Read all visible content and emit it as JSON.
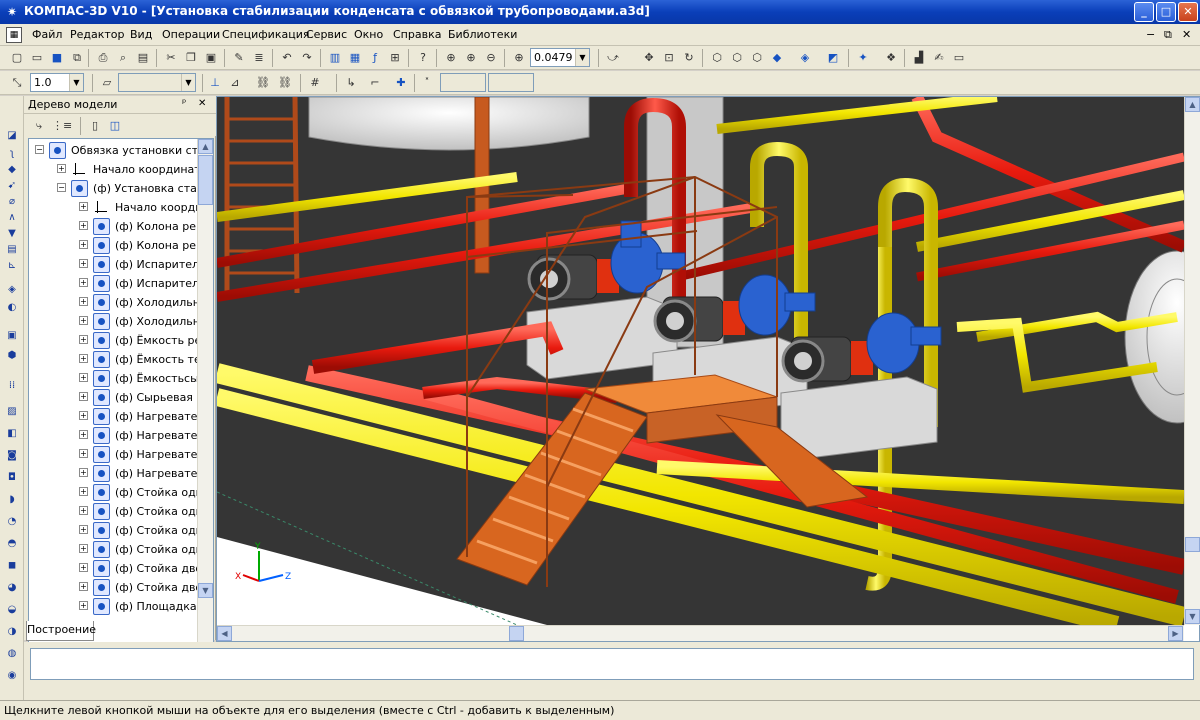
{
  "window": {
    "title": "КОМПАС-3D V10 - [Установка стабилизации конденсата с обвязкой трубопроводами.a3d]",
    "minimize_label": "_",
    "maximize_label": "□",
    "close_label": "✕"
  },
  "menu": {
    "items": [
      "Файл",
      "Редактор",
      "Вид",
      "Операции",
      "Спецификация",
      "Сервис",
      "Окно",
      "Справка",
      "Библиотеки"
    ],
    "right_controls": [
      "−",
      "⧉",
      "✕"
    ]
  },
  "toolbar": {
    "zoom_value": "0.0479",
    "step_value": "1.0"
  },
  "model_tree": {
    "title": "Дерево модели",
    "pin_label": "ᵖ",
    "close_label": "✕",
    "items": [
      {
        "level": 0,
        "expander": "−",
        "icon": "assembly-icon",
        "label": "Обвязка установки стабилиз"
      },
      {
        "level": 1,
        "expander": "+",
        "icon": "axis-icon",
        "label": "Начало координат"
      },
      {
        "level": 1,
        "expander": "−",
        "icon": "assembly-icon",
        "label": "(ф) Установка стабилиз"
      },
      {
        "level": 2,
        "expander": "+",
        "icon": "axis-icon",
        "label": "Начало координат"
      },
      {
        "level": 2,
        "expander": "+",
        "icon": "part-icon",
        "label": "(ф) Колона ректиф"
      },
      {
        "level": 2,
        "expander": "+",
        "icon": "part-icon",
        "label": "(ф) Колона ректиф"
      },
      {
        "level": 2,
        "expander": "+",
        "icon": "part-icon",
        "label": "(ф) Испаритель И -"
      },
      {
        "level": 2,
        "expander": "+",
        "icon": "part-icon",
        "label": "(ф) Испаритель И -"
      },
      {
        "level": 2,
        "expander": "+",
        "icon": "part-icon",
        "label": "(ф) Холодильник - "
      },
      {
        "level": 2,
        "expander": "+",
        "icon": "part-icon",
        "label": "(ф) Холодильник - "
      },
      {
        "level": 2,
        "expander": "+",
        "icon": "part-icon",
        "label": "(ф) Ёмкость рефлю"
      },
      {
        "level": 2,
        "expander": "+",
        "icon": "part-icon",
        "label": "(ф) Ёмкость теплон"
      },
      {
        "level": 2,
        "expander": "+",
        "icon": "part-icon",
        "label": "(ф) Ёмкостьсырьев"
      },
      {
        "level": 2,
        "expander": "+",
        "icon": "part-icon",
        "label": "(ф) Сырьевая ёмко"
      },
      {
        "level": 2,
        "expander": "+",
        "icon": "part-icon",
        "label": "(ф) Нагреватель сы"
      },
      {
        "level": 2,
        "expander": "+",
        "icon": "part-icon",
        "label": "(ф) Нагреватель сы"
      },
      {
        "level": 2,
        "expander": "+",
        "icon": "part-icon",
        "label": "(ф) Нагреватель сы"
      },
      {
        "level": 2,
        "expander": "+",
        "icon": "part-icon",
        "label": "(ф) Нагреватель сы"
      },
      {
        "level": 2,
        "expander": "+",
        "icon": "part-icon",
        "label": "(ф) Стойка одинар"
      },
      {
        "level": 2,
        "expander": "+",
        "icon": "part-icon",
        "label": "(ф) Стойка одинар"
      },
      {
        "level": 2,
        "expander": "+",
        "icon": "part-icon",
        "label": "(ф) Стойка одинар"
      },
      {
        "level": 2,
        "expander": "+",
        "icon": "part-icon",
        "label": "(ф) Стойка одинар"
      },
      {
        "level": 2,
        "expander": "+",
        "icon": "part-icon",
        "label": "(ф) Стойка двойна"
      },
      {
        "level": 2,
        "expander": "+",
        "icon": "part-icon",
        "label": "(ф) Стойка двойна"
      },
      {
        "level": 2,
        "expander": "+",
        "icon": "part-icon",
        "label": "(ф) Площадка"
      }
    ],
    "tab_label": "Построение"
  },
  "viewport": {
    "axis_labels": {
      "x": "X",
      "y": "Y",
      "z": "Z"
    },
    "colors": {
      "background": "#353535",
      "pipe_yellow": "#f2e600",
      "pipe_red": "#e81a0e",
      "stairs": "#e2661f",
      "pump": "#2a62d0",
      "floor": "#ffffff"
    }
  },
  "status_bar": {
    "message": "Щелкните левой кнопкой мыши на объекте для его выделения (вместе с Ctrl - добавить к выделенным)"
  }
}
